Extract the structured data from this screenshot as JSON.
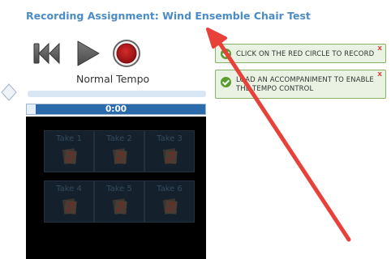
{
  "page": {
    "title": "Recording Assignment: Wind Ensemble Chair Test"
  },
  "player": {
    "tempo_label": "Normal Tempo",
    "time": "0:00",
    "progress_fraction": 0.05,
    "icons": [
      "rewind-icon",
      "play-icon",
      "record-icon"
    ]
  },
  "takes": [
    {
      "label": "Take 1"
    },
    {
      "label": "Take 2"
    },
    {
      "label": "Take 3"
    },
    {
      "label": "Take 4"
    },
    {
      "label": "Take 5"
    },
    {
      "label": "Take 6"
    }
  ],
  "notifications": [
    {
      "text": "CLICK ON THE RED CIRCLE TO RECORD",
      "close": "x"
    },
    {
      "text_line1": "LOAD AN ACCOMPANIMENT TO ENABLE",
      "text_line2": "THE TEMPO CONTROL",
      "close": "x"
    }
  ],
  "colors": {
    "title": "#4a8cc7",
    "record": "#c0171b",
    "progress": "#2b6bab",
    "notification_bg": "#eaf3e3",
    "notification_border": "#86b466",
    "annotation_arrow": "#e8413a"
  }
}
